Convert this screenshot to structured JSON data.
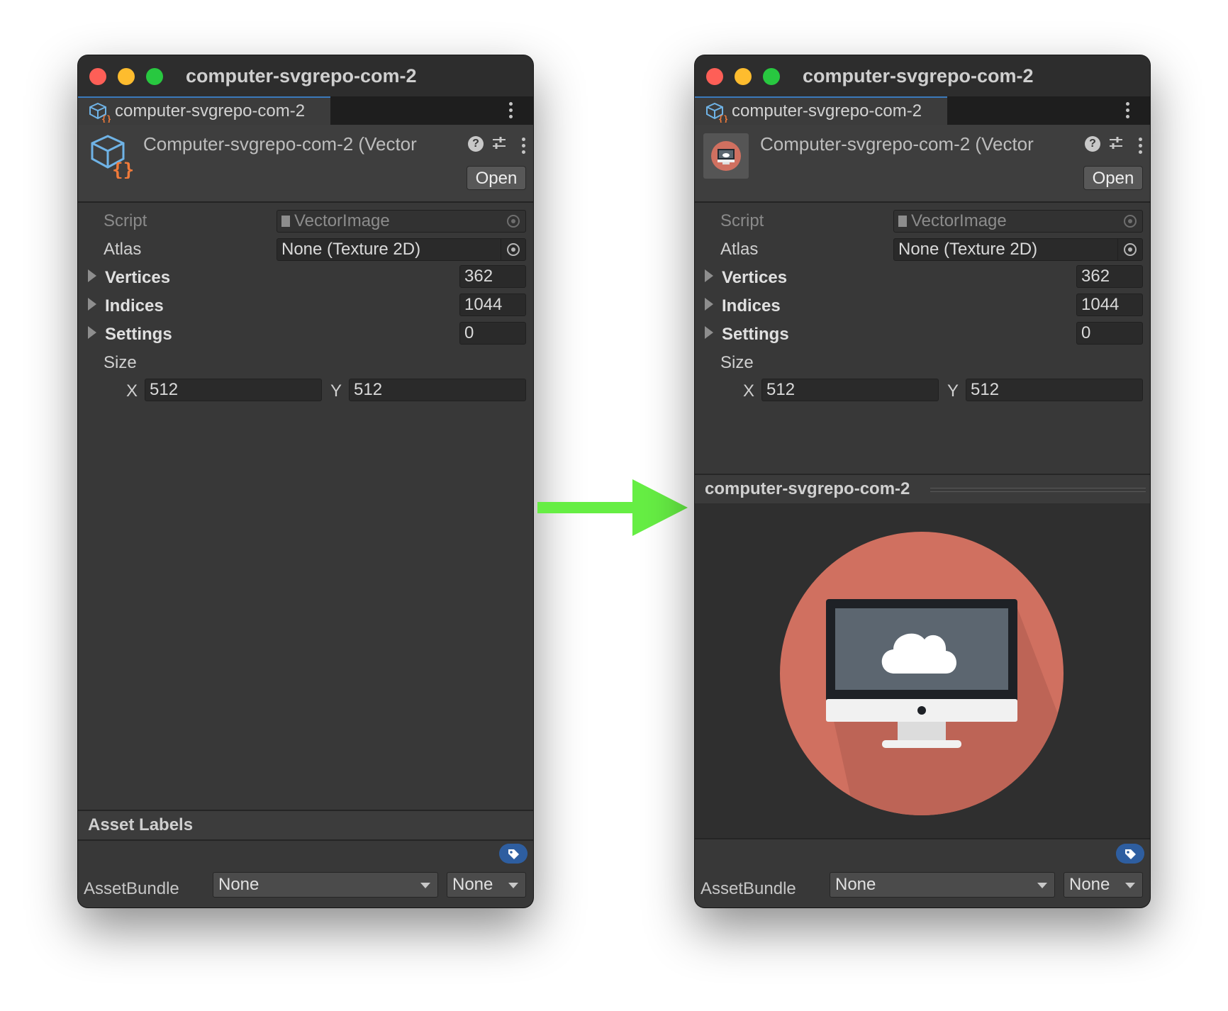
{
  "windows": [
    {
      "title": "computer-svgrepo-com-2",
      "tab_label": "computer-svgrepo-com-2",
      "header_title": "Computer-svgrepo-com-2 (Vector",
      "open_label": "Open",
      "fields": {
        "script_label": "Script",
        "script_value": "VectorImage",
        "atlas_label": "Atlas",
        "atlas_value": "None (Texture 2D)",
        "vertices_label": "Vertices",
        "vertices_value": "362",
        "indices_label": "Indices",
        "indices_value": "1044",
        "settings_label": "Settings",
        "settings_value": "0",
        "size_label": "Size",
        "x_label": "X",
        "x_value": "512",
        "y_label": "Y",
        "y_value": "512"
      },
      "asset_labels_title": "Asset Labels",
      "asset_bundle_label": "AssetBundle",
      "asset_bundle_value": "None",
      "asset_variant_value": "None"
    },
    {
      "title": "computer-svgrepo-com-2",
      "tab_label": "computer-svgrepo-com-2",
      "header_title": "Computer-svgrepo-com-2 (Vector",
      "open_label": "Open",
      "fields": {
        "script_label": "Script",
        "script_value": "VectorImage",
        "atlas_label": "Atlas",
        "atlas_value": "None (Texture 2D)",
        "vertices_label": "Vertices",
        "vertices_value": "362",
        "indices_label": "Indices",
        "indices_value": "1044",
        "settings_label": "Settings",
        "settings_value": "0",
        "size_label": "Size",
        "x_label": "X",
        "x_value": "512",
        "y_label": "Y",
        "y_value": "512"
      },
      "preview_title": "computer-svgrepo-com-2",
      "asset_bundle_label": "AssetBundle",
      "asset_bundle_value": "None",
      "asset_variant_value": "None"
    }
  ],
  "colors": {
    "window_bg": "#383838",
    "accent_tab": "#3a79bb",
    "arrow_green": "#66ee44",
    "preview_circle": "#d07060"
  },
  "icons": [
    "vector-asset-icon",
    "help-icon",
    "sliders-icon",
    "kebab-menu-icon",
    "object-picker-icon",
    "foldout-arrow-icon",
    "tag-icon",
    "dropdown-arrow-icon",
    "computer-cloud-icon",
    "right-arrow-icon"
  ]
}
